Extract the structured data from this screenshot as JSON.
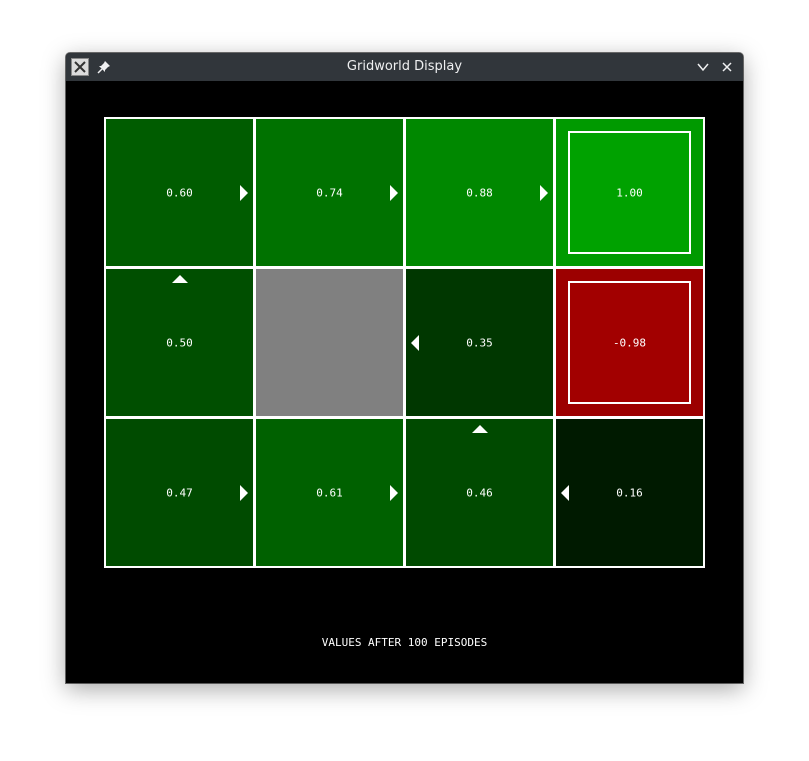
{
  "window": {
    "title": "Gridworld Display"
  },
  "icons": {
    "app": "x-app-icon",
    "pin": "pin-icon",
    "minimize": "chevron-down-icon",
    "close": "close-icon"
  },
  "grid": {
    "rows": 3,
    "cols": 4,
    "cells": [
      {
        "row": 0,
        "col": 0,
        "value": "0.60",
        "color": "#005c00",
        "arrow": "east",
        "terminal": false
      },
      {
        "row": 0,
        "col": 1,
        "value": "0.74",
        "color": "#007200",
        "arrow": "east",
        "terminal": false
      },
      {
        "row": 0,
        "col": 2,
        "value": "0.88",
        "color": "#008800",
        "arrow": "east",
        "terminal": false
      },
      {
        "row": 0,
        "col": 3,
        "value": "1.00",
        "color": "#009a00",
        "inner_color": "#00a200",
        "arrow": "",
        "terminal": true
      },
      {
        "row": 1,
        "col": 0,
        "value": "0.50",
        "color": "#004f00",
        "arrow": "north",
        "terminal": false
      },
      {
        "row": 1,
        "col": 1,
        "value": "",
        "color": "#808080",
        "arrow": "",
        "wall": true,
        "terminal": false
      },
      {
        "row": 1,
        "col": 2,
        "value": "0.35",
        "color": "#003700",
        "arrow": "west",
        "terminal": false
      },
      {
        "row": 1,
        "col": 3,
        "value": "-0.98",
        "color": "#9c0000",
        "inner_color": "#a20000",
        "arrow": "",
        "terminal": true
      },
      {
        "row": 2,
        "col": 0,
        "value": "0.47",
        "color": "#004b00",
        "arrow": "east",
        "terminal": false
      },
      {
        "row": 2,
        "col": 1,
        "value": "0.61",
        "color": "#006100",
        "arrow": "east",
        "terminal": false
      },
      {
        "row": 2,
        "col": 2,
        "value": "0.46",
        "color": "#004a00",
        "arrow": "north",
        "terminal": false
      },
      {
        "row": 2,
        "col": 3,
        "value": "0.16",
        "color": "#001a00",
        "arrow": "west",
        "terminal": false
      }
    ]
  },
  "caption": "VALUES AFTER 100 EPISODES"
}
